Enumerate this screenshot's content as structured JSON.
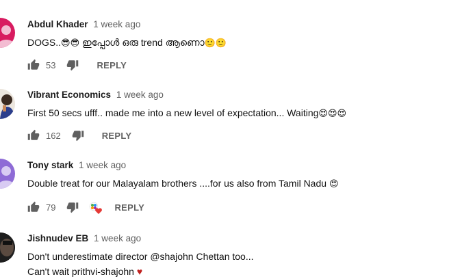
{
  "comments": [
    {
      "author": "Abdul Khader",
      "time": "1 week ago",
      "text_a": "DOGS..",
      "emoji_a": "😎😎",
      "text_b": " ഇപ്പോൾ ഒരു trend ആണൊ",
      "emoji_b": "🙂🙂",
      "likes": "53",
      "reply_label": "REPLY",
      "avatar_color": "#d81b60"
    },
    {
      "author": "Vibrant Economics",
      "time": "1 week ago",
      "text_a": "First 50 secs ufff.. made me into a new level of expectation... Waiting",
      "emoji_a": "😍😍😍",
      "likes": "162",
      "reply_label": "REPLY"
    },
    {
      "author": "Tony stark",
      "time": "1 week ago",
      "text_a": "Double treat for our Malayalam brothers ....for us also from Tamil Nadu ",
      "emoji_a": "😍",
      "likes": "79",
      "reply_label": "REPLY",
      "avatar_color": "#8e6bd6"
    },
    {
      "author": "Jishnudev EB",
      "time": "1 week ago",
      "line1": "Don't underestimate director @shajohn Chettan too...",
      "line2_text": "Can't wait prithvi-shajohn ",
      "line2_heart": "♥"
    }
  ]
}
